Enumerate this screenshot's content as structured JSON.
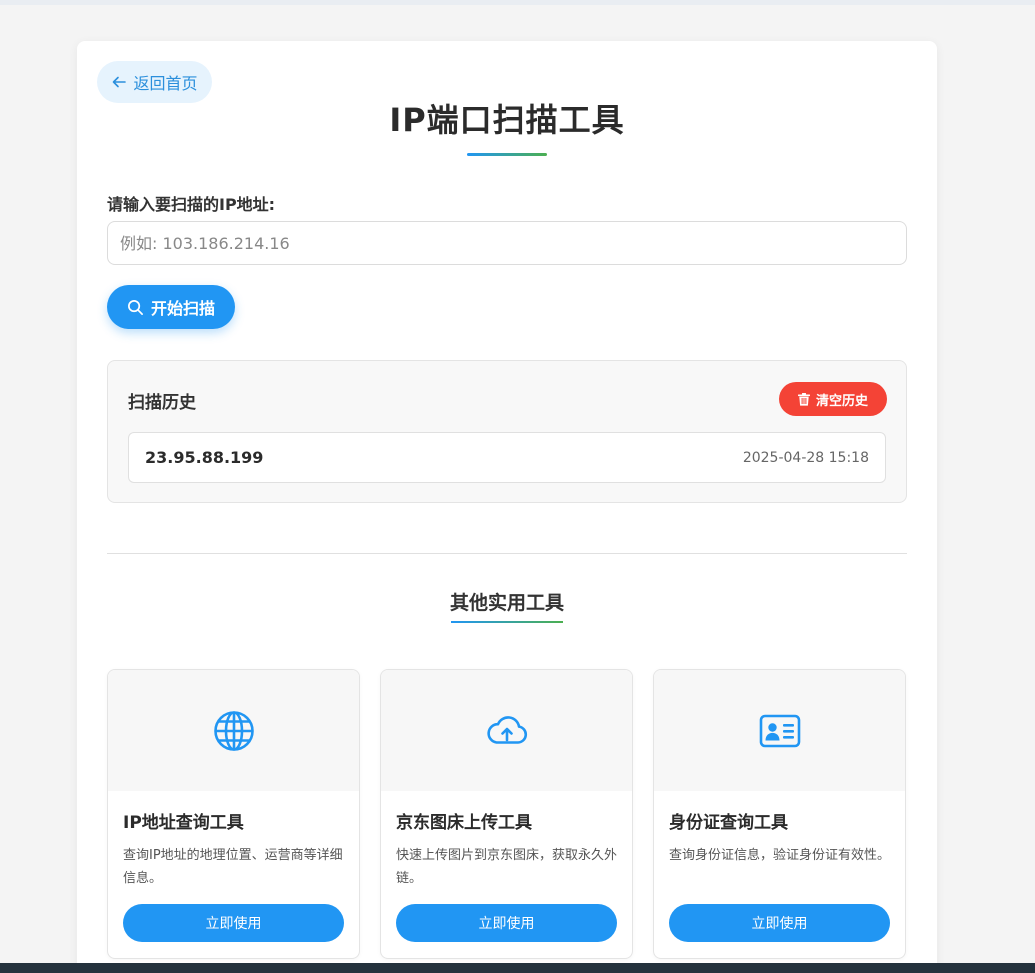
{
  "nav": {
    "back_label": "返回首页"
  },
  "page": {
    "title": "IP端口扫描工具"
  },
  "scan": {
    "input_label": "请输入要扫描的IP地址:",
    "input_value": "",
    "input_placeholder": "例如: 103.186.214.16",
    "scan_button": "开始扫描"
  },
  "history": {
    "title": "扫描历史",
    "clear_button": "清空历史",
    "items": [
      {
        "ip": "23.95.88.199",
        "time": "2025-04-28 15:18"
      }
    ]
  },
  "tools": {
    "section_title": "其他实用工具",
    "cards": [
      {
        "name": "IP地址查询工具",
        "description": "查询IP地址的地理位置、运营商等详细信息。",
        "button": "立即使用",
        "icon": "globe-icon"
      },
      {
        "name": "京东图床上传工具",
        "description": "快速上传图片到京东图床，获取永久外链。",
        "button": "立即使用",
        "icon": "cloud-upload-icon"
      },
      {
        "name": "身份证查询工具",
        "description": "查询身份证信息，验证身份证有效性。",
        "button": "立即使用",
        "icon": "id-card-icon"
      }
    ]
  },
  "colors": {
    "primary": "#2196f3",
    "danger": "#f44336",
    "accent_gradient_end": "#4caf50"
  }
}
